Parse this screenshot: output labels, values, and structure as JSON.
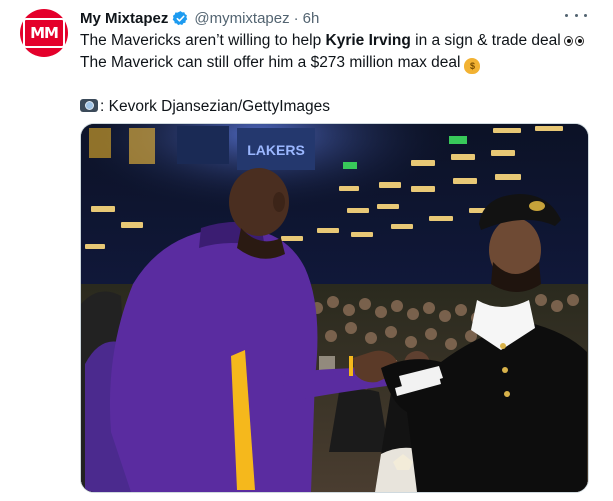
{
  "author": {
    "display_name": "My Mixtapez",
    "avatar_text": "MM",
    "handle": "@mymixtapez",
    "separator": "·",
    "time": "6h",
    "verified_icon": "verified-badge-icon"
  },
  "tweet": {
    "line1_before": "The Mavericks aren’t willing to help ",
    "line1_bold": "Kyrie Irving",
    "line1_after": " in a sign & trade deal",
    "line2": "The Maverick can still offer him a $273 million max deal",
    "credit": ": Kevork Djansezian/GettyImages",
    "emojis": [
      "eyes-emoji",
      "money-bag-emoji",
      "camera-emoji"
    ]
  },
  "media": {
    "scoreboard_text": "LAKERS",
    "jersey_color": "#5a2ca0",
    "jersey_trim": "#f5b81c"
  },
  "colors": {
    "brand": "#e4002b",
    "verified": "#1d9bf0",
    "muted": "#536471"
  }
}
